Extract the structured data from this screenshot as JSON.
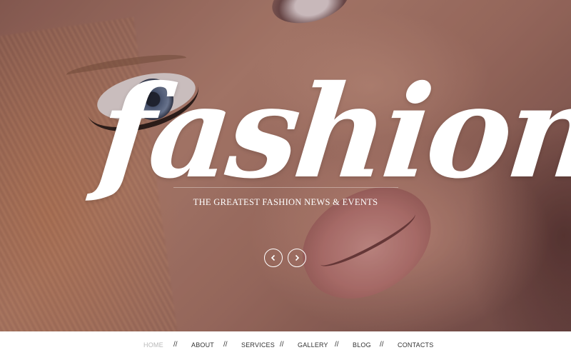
{
  "hero": {
    "title": "fashion",
    "tagline": "THE GREATEST FASHION NEWS & EVENTS",
    "prev_icon": "chevron-left-icon",
    "next_icon": "chevron-right-icon"
  },
  "nav": {
    "items": [
      {
        "label": "HOME",
        "active": true
      },
      {
        "label": "ABOUT",
        "active": false
      },
      {
        "label": "SERVICES",
        "active": false
      },
      {
        "label": "GALLERY",
        "active": false
      },
      {
        "label": "BLOG",
        "active": false
      },
      {
        "label": "CONTACTS",
        "active": false
      }
    ],
    "separator": "//"
  },
  "colors": {
    "menu_text": "#333333",
    "menu_active": "#b8b8b8",
    "title": "#ffffff"
  }
}
